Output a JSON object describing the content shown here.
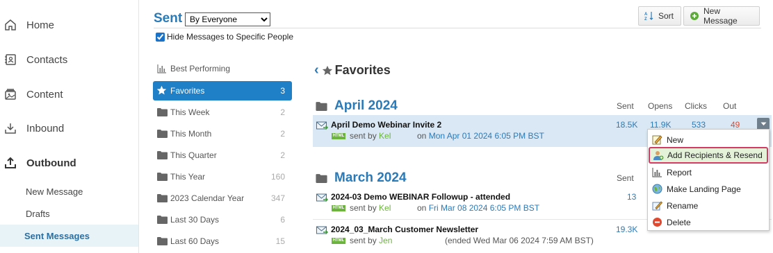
{
  "leftnav": {
    "items": [
      {
        "label": "Home",
        "icon": "home-icon"
      },
      {
        "label": "Contacts",
        "icon": "contacts-icon"
      },
      {
        "label": "Content",
        "icon": "content-icon"
      },
      {
        "label": "Inbound",
        "icon": "inbound-icon"
      },
      {
        "label": "Outbound",
        "icon": "outbound-icon"
      }
    ],
    "subitems": [
      {
        "label": "New Message"
      },
      {
        "label": "Drafts"
      },
      {
        "label": "Sent Messages"
      }
    ]
  },
  "header": {
    "title": "Sent",
    "view_selected": "By Everyone",
    "hide_label": "Hide Messages to Specific People",
    "hide_checked": true,
    "sort_label": "Sort",
    "new_message_label": "New Message"
  },
  "folders": [
    {
      "label": "Best Performing",
      "count": "",
      "icon": "bar-chart-icon"
    },
    {
      "label": "Favorites",
      "count": "3",
      "icon": "star-icon"
    },
    {
      "label": "This Week",
      "count": "2",
      "icon": "folder-icon"
    },
    {
      "label": "This Month",
      "count": "2",
      "icon": "folder-icon"
    },
    {
      "label": "This Quarter",
      "count": "2",
      "icon": "folder-icon"
    },
    {
      "label": "This Year",
      "count": "160",
      "icon": "folder-icon"
    },
    {
      "label": "2023 Calendar Year",
      "count": "347",
      "icon": "folder-icon"
    },
    {
      "label": "Last 30 Days",
      "count": "6",
      "icon": "folder-icon"
    },
    {
      "label": "Last 60 Days",
      "count": "15",
      "icon": "folder-icon"
    }
  ],
  "main": {
    "title": "Favorites",
    "columns": {
      "sent": "Sent",
      "opens": "Opens",
      "clicks": "Clicks",
      "out": "Out"
    },
    "groups": [
      {
        "month": "April 2024",
        "messages": [
          {
            "title": "April Demo Webinar Invite 2",
            "badge": "HTML",
            "sent_by_prefix": "sent by",
            "sender": "Kel",
            "on_prefix": "on",
            "date": "Mon Apr 01 2024 6:05 PM BST",
            "sent": "18.5K",
            "opens": "11.9K",
            "clicks": "533",
            "out": "49"
          }
        ]
      },
      {
        "month": "March 2024",
        "messages": [
          {
            "title": "2024-03 Demo WEBINAR Followup - attended",
            "badge": "HTML",
            "sent_by_prefix": "sent by",
            "sender": "Kel",
            "on_prefix": "on",
            "date": "Fri Mar 08 2024 6:05 PM BST",
            "sent": "13"
          },
          {
            "title": "2024_03_March Customer Newsletter",
            "badge": "HTML",
            "sent_by_prefix": "sent by",
            "sender": "Jen",
            "ended": "(ended Wed Mar 06 2024 7:59 AM BST)",
            "sent": "19.3K"
          }
        ]
      }
    ]
  },
  "menu": {
    "items": [
      {
        "label": "New",
        "icon": "new-icon"
      },
      {
        "label": "Add Recipients & Resend",
        "icon": "add-recipients-icon",
        "highlighted": true
      },
      {
        "label": "Report",
        "icon": "report-icon"
      },
      {
        "label": "Make Landing Page",
        "icon": "landing-page-icon"
      },
      {
        "label": "Rename",
        "icon": "rename-icon"
      },
      {
        "label": "Delete",
        "icon": "delete-icon"
      }
    ]
  },
  "colors": {
    "accent": "#2b7ab8",
    "active_folder": "#1f7fc7",
    "selected_row": "#d9e8f4",
    "highlight_border": "#d33b63",
    "sender_green": "#6cb33f",
    "out_red": "#e0482f"
  }
}
